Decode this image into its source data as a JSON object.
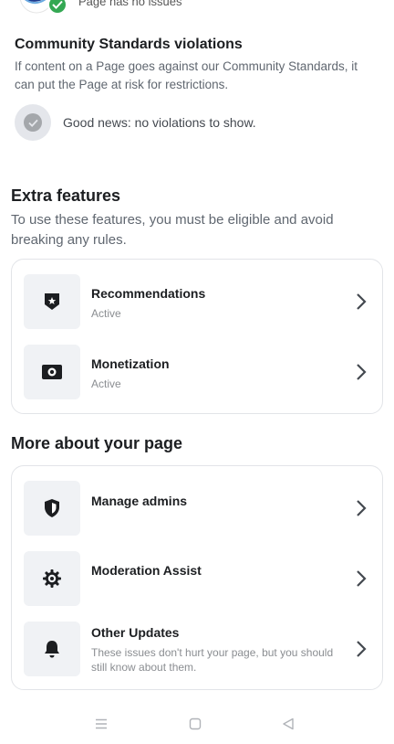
{
  "header": {
    "caption": "Page has no issues"
  },
  "community_standards": {
    "title": "Community Standards violations",
    "description": "If content on a Page goes against our Community Standards, it can put the Page at risk for restrictions.",
    "status_text": "Good news: no violations to show."
  },
  "extra_features": {
    "title": "Extra features",
    "description": "To use these features, you must be eligible and avoid breaking any rules.",
    "items": [
      {
        "title": "Recommendations",
        "status": "Active",
        "icon": "recommendation-badge-icon"
      },
      {
        "title": "Monetization",
        "status": "Active",
        "icon": "money-icon"
      }
    ]
  },
  "more_about": {
    "title": "More about your page",
    "items": [
      {
        "title": "Manage admins",
        "subtitle": "",
        "icon": "shield-icon"
      },
      {
        "title": "Moderation Assist",
        "subtitle": "",
        "icon": "gear-icon"
      },
      {
        "title": "Other Updates",
        "subtitle": "These issues don't hurt your page, but you should still know about them.",
        "icon": "bell-icon"
      }
    ]
  },
  "colors": {
    "accent_green": "#34a853",
    "card_border": "#e2e4e8",
    "icon_bg": "#f0f2f5"
  },
  "system_nav": {
    "buttons": [
      "menu-icon",
      "home-square-icon",
      "back-triangle-icon"
    ]
  }
}
